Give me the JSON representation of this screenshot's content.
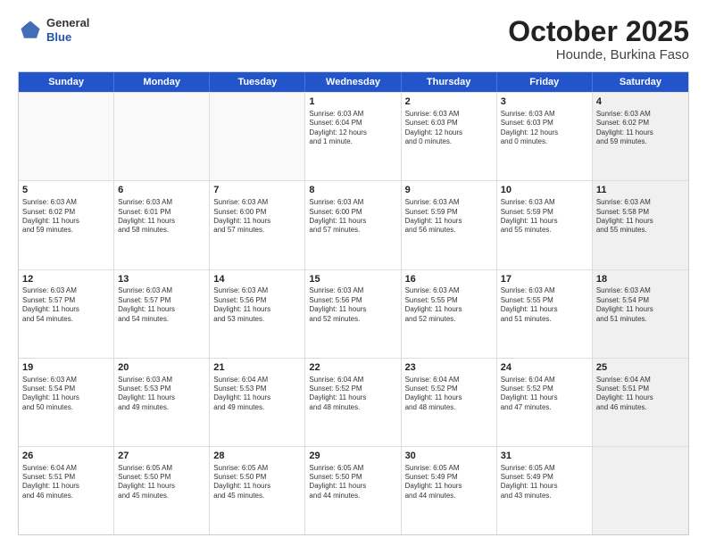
{
  "logo": {
    "general": "General",
    "blue": "Blue"
  },
  "title": "October 2025",
  "subtitle": "Hounde, Burkina Faso",
  "header_days": [
    "Sunday",
    "Monday",
    "Tuesday",
    "Wednesday",
    "Thursday",
    "Friday",
    "Saturday"
  ],
  "rows": [
    [
      {
        "day": "",
        "text": "",
        "empty": true
      },
      {
        "day": "",
        "text": "",
        "empty": true
      },
      {
        "day": "",
        "text": "",
        "empty": true
      },
      {
        "day": "1",
        "text": "Sunrise: 6:03 AM\nSunset: 6:04 PM\nDaylight: 12 hours\nand 1 minute."
      },
      {
        "day": "2",
        "text": "Sunrise: 6:03 AM\nSunset: 6:03 PM\nDaylight: 12 hours\nand 0 minutes."
      },
      {
        "day": "3",
        "text": "Sunrise: 6:03 AM\nSunset: 6:03 PM\nDaylight: 12 hours\nand 0 minutes."
      },
      {
        "day": "4",
        "text": "Sunrise: 6:03 AM\nSunset: 6:02 PM\nDaylight: 11 hours\nand 59 minutes.",
        "shaded": true
      }
    ],
    [
      {
        "day": "5",
        "text": "Sunrise: 6:03 AM\nSunset: 6:02 PM\nDaylight: 11 hours\nand 59 minutes."
      },
      {
        "day": "6",
        "text": "Sunrise: 6:03 AM\nSunset: 6:01 PM\nDaylight: 11 hours\nand 58 minutes."
      },
      {
        "day": "7",
        "text": "Sunrise: 6:03 AM\nSunset: 6:00 PM\nDaylight: 11 hours\nand 57 minutes."
      },
      {
        "day": "8",
        "text": "Sunrise: 6:03 AM\nSunset: 6:00 PM\nDaylight: 11 hours\nand 57 minutes."
      },
      {
        "day": "9",
        "text": "Sunrise: 6:03 AM\nSunset: 5:59 PM\nDaylight: 11 hours\nand 56 minutes."
      },
      {
        "day": "10",
        "text": "Sunrise: 6:03 AM\nSunset: 5:59 PM\nDaylight: 11 hours\nand 55 minutes."
      },
      {
        "day": "11",
        "text": "Sunrise: 6:03 AM\nSunset: 5:58 PM\nDaylight: 11 hours\nand 55 minutes.",
        "shaded": true
      }
    ],
    [
      {
        "day": "12",
        "text": "Sunrise: 6:03 AM\nSunset: 5:57 PM\nDaylight: 11 hours\nand 54 minutes."
      },
      {
        "day": "13",
        "text": "Sunrise: 6:03 AM\nSunset: 5:57 PM\nDaylight: 11 hours\nand 54 minutes."
      },
      {
        "day": "14",
        "text": "Sunrise: 6:03 AM\nSunset: 5:56 PM\nDaylight: 11 hours\nand 53 minutes."
      },
      {
        "day": "15",
        "text": "Sunrise: 6:03 AM\nSunset: 5:56 PM\nDaylight: 11 hours\nand 52 minutes."
      },
      {
        "day": "16",
        "text": "Sunrise: 6:03 AM\nSunset: 5:55 PM\nDaylight: 11 hours\nand 52 minutes."
      },
      {
        "day": "17",
        "text": "Sunrise: 6:03 AM\nSunset: 5:55 PM\nDaylight: 11 hours\nand 51 minutes."
      },
      {
        "day": "18",
        "text": "Sunrise: 6:03 AM\nSunset: 5:54 PM\nDaylight: 11 hours\nand 51 minutes.",
        "shaded": true
      }
    ],
    [
      {
        "day": "19",
        "text": "Sunrise: 6:03 AM\nSunset: 5:54 PM\nDaylight: 11 hours\nand 50 minutes."
      },
      {
        "day": "20",
        "text": "Sunrise: 6:03 AM\nSunset: 5:53 PM\nDaylight: 11 hours\nand 49 minutes."
      },
      {
        "day": "21",
        "text": "Sunrise: 6:04 AM\nSunset: 5:53 PM\nDaylight: 11 hours\nand 49 minutes."
      },
      {
        "day": "22",
        "text": "Sunrise: 6:04 AM\nSunset: 5:52 PM\nDaylight: 11 hours\nand 48 minutes."
      },
      {
        "day": "23",
        "text": "Sunrise: 6:04 AM\nSunset: 5:52 PM\nDaylight: 11 hours\nand 48 minutes."
      },
      {
        "day": "24",
        "text": "Sunrise: 6:04 AM\nSunset: 5:52 PM\nDaylight: 11 hours\nand 47 minutes."
      },
      {
        "day": "25",
        "text": "Sunrise: 6:04 AM\nSunset: 5:51 PM\nDaylight: 11 hours\nand 46 minutes.",
        "shaded": true
      }
    ],
    [
      {
        "day": "26",
        "text": "Sunrise: 6:04 AM\nSunset: 5:51 PM\nDaylight: 11 hours\nand 46 minutes."
      },
      {
        "day": "27",
        "text": "Sunrise: 6:05 AM\nSunset: 5:50 PM\nDaylight: 11 hours\nand 45 minutes."
      },
      {
        "day": "28",
        "text": "Sunrise: 6:05 AM\nSunset: 5:50 PM\nDaylight: 11 hours\nand 45 minutes."
      },
      {
        "day": "29",
        "text": "Sunrise: 6:05 AM\nSunset: 5:50 PM\nDaylight: 11 hours\nand 44 minutes."
      },
      {
        "day": "30",
        "text": "Sunrise: 6:05 AM\nSunset: 5:49 PM\nDaylight: 11 hours\nand 44 minutes."
      },
      {
        "day": "31",
        "text": "Sunrise: 6:05 AM\nSunset: 5:49 PM\nDaylight: 11 hours\nand 43 minutes."
      },
      {
        "day": "",
        "text": "",
        "empty": true,
        "shaded": true
      }
    ]
  ]
}
